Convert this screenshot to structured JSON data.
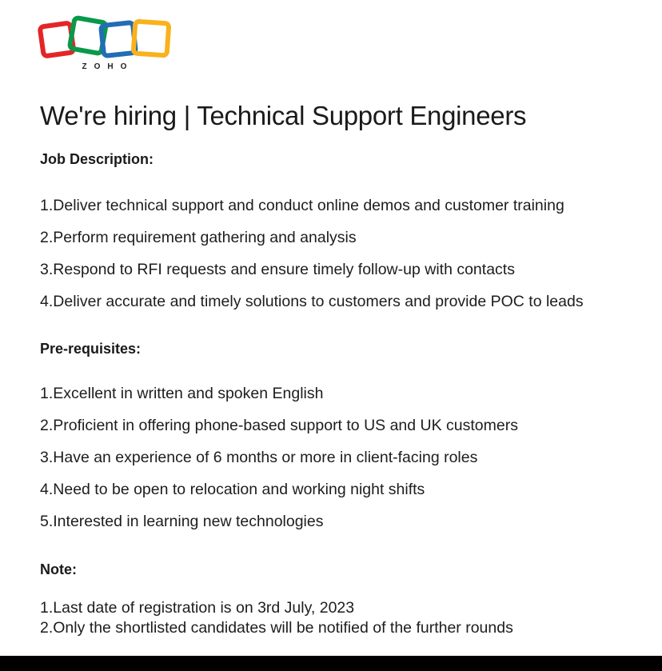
{
  "logo": {
    "wordmark": "ZOHO",
    "colors": {
      "red": "#e42527",
      "green": "#089949",
      "blue": "#226db4",
      "yellow": "#f9b21d"
    }
  },
  "title": "We're hiring | Technical Support Engineers",
  "job_description": {
    "heading": "Job Description:",
    "items": [
      "1.Deliver technical support and conduct online demos and customer training",
      "2.Perform requirement gathering and analysis",
      "3.Respond to RFI requests and ensure timely follow-up with contacts",
      "4.Deliver accurate and timely solutions to customers and provide POC to leads"
    ]
  },
  "prerequisites": {
    "heading": "Pre-requisites:",
    "items": [
      "1.Excellent in written and spoken English",
      "2.Proficient in offering phone-based support to US and UK customers",
      "3.Have an experience of 6 months or more in client-facing roles",
      "4.Need to be open to relocation and working night shifts",
      "5.Interested in learning new technologies"
    ]
  },
  "note": {
    "heading": "Note:",
    "items": [
      "1.Last date of registration is on 3rd July, 2023",
      "2.Only the shortlisted candidates will be notified of the further rounds"
    ]
  }
}
